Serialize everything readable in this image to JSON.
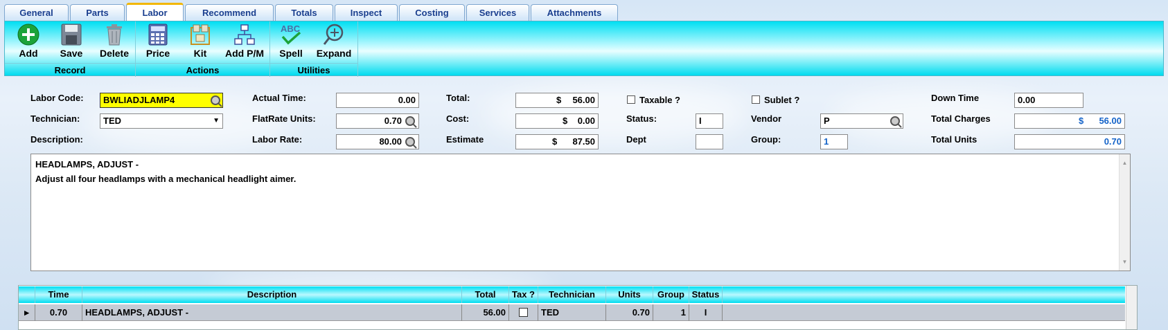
{
  "tabs": [
    "General",
    "Parts",
    "Labor",
    "Recommend",
    "Totals",
    "Inspect",
    "Costing",
    "Services",
    "Attachments"
  ],
  "active_tab": "Labor",
  "ribbon": {
    "groups": {
      "record": "Record",
      "actions": "Actions",
      "utilities": "Utilities"
    },
    "buttons": {
      "add": "Add",
      "save": "Save",
      "delete": "Delete",
      "price": "Price",
      "kit": "Kit",
      "add_pm": "Add P/M",
      "spell": "Spell",
      "expand": "Expand"
    },
    "spell_icon_text": "ABC"
  },
  "form": {
    "labor_code_label": "Labor Code:",
    "labor_code": "BWLIADJLAMP4",
    "technician_label": "Technician:",
    "technician": "TED",
    "description_label": "Description:",
    "actual_time_label": "Actual Time:",
    "actual_time": "0.00",
    "flatrate_label": "FlatRate Units:",
    "flatrate": "0.70",
    "labor_rate_label": "Labor Rate:",
    "labor_rate": "80.00",
    "total_label": "Total:",
    "total_cur": "$",
    "total": "56.00",
    "cost_label": "Cost:",
    "cost_cur": "$",
    "cost": "0.00",
    "estimate_label": "Estimate",
    "estimate_cur": "$",
    "estimate": "87.50",
    "taxable_label": "Taxable ?",
    "status_label": "Status:",
    "status": "I",
    "dept_label": "Dept",
    "dept": "",
    "sublet_label": "Sublet ?",
    "vendor_label": "Vendor",
    "vendor": "P",
    "group_label": "Group:",
    "group": "1",
    "down_time_label": "Down Time",
    "down_time": "0.00",
    "total_charges_label": "Total Charges",
    "total_charges_cur": "$",
    "total_charges": "56.00",
    "total_units_label": "Total Units",
    "total_units": "0.70"
  },
  "description_text": {
    "line1": "HEADLAMPS, ADJUST -",
    "line2": "Adjust all four headlamps with a mechanical headlight aimer."
  },
  "grid": {
    "columns": [
      "Time",
      "Description",
      "Total",
      "Tax ?",
      "Technician",
      "Units",
      "Group",
      "Status"
    ],
    "rows": [
      {
        "time": "0.70",
        "description": "HEADLAMPS, ADJUST -",
        "total": "56.00",
        "tech": "TED",
        "units": "0.70",
        "group": "1",
        "status": "I"
      }
    ]
  },
  "colors": {
    "ribbon": "#00dff2",
    "highlight": "#ffff00",
    "accent_blue": "#1463c8"
  }
}
